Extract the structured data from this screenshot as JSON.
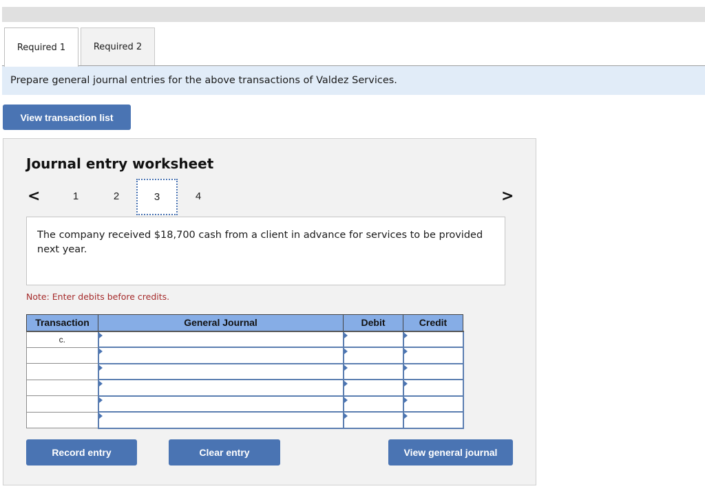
{
  "tabs": [
    {
      "label": "Required 1",
      "active": true
    },
    {
      "label": "Required 2",
      "active": false
    }
  ],
  "instruction": "Prepare general journal entries for the above transactions of Valdez Services.",
  "buttons": {
    "view_transaction_list": "View transaction list",
    "record_entry": "Record entry",
    "clear_entry": "Clear entry",
    "view_general_journal": "View general journal"
  },
  "worksheet": {
    "title": "Journal entry worksheet",
    "pager": {
      "prev_icon": "chevron-left-icon",
      "next_icon": "chevron-right-icon",
      "prev_glyph": "<",
      "next_glyph": ">",
      "pages": [
        "1",
        "2",
        "3",
        "4"
      ],
      "current": "3"
    },
    "description": "The company received $18,700 cash from a client in advance for services to be provided next year.",
    "note": "Note: Enter debits before credits.",
    "table": {
      "headers": [
        "Transaction",
        "General Journal",
        "Debit",
        "Credit"
      ],
      "rows": [
        {
          "transaction": "c.",
          "account": "",
          "debit": "",
          "credit": ""
        },
        {
          "transaction": "",
          "account": "",
          "debit": "",
          "credit": ""
        },
        {
          "transaction": "",
          "account": "",
          "debit": "",
          "credit": ""
        },
        {
          "transaction": "",
          "account": "",
          "debit": "",
          "credit": ""
        },
        {
          "transaction": "",
          "account": "",
          "debit": "",
          "credit": ""
        },
        {
          "transaction": "",
          "account": "",
          "debit": "",
          "credit": ""
        }
      ]
    }
  },
  "colors": {
    "accent": "#4a74b3",
    "header_blue": "#86ade6",
    "instruction_bg": "#e1ecf8",
    "note_red": "#a52a2a"
  }
}
